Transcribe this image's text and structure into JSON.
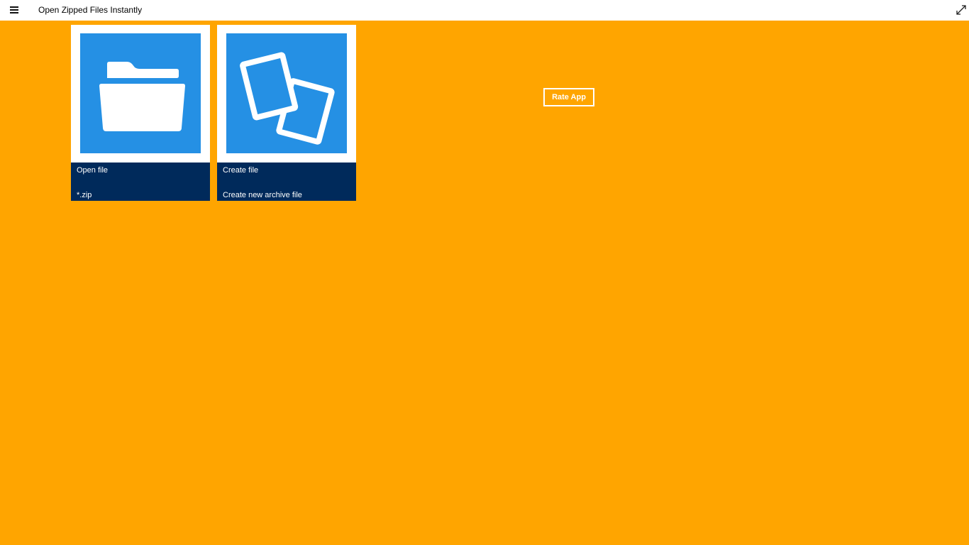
{
  "window": {
    "title": "Open Zipped Files Instantly",
    "menu_icon": "hamburger-menu-icon",
    "expand_icon": "expand-icon"
  },
  "tiles": [
    {
      "title": "Open file",
      "subtitle": "*.zip",
      "icon": "folder-icon"
    },
    {
      "title": "Create file",
      "subtitle": "Create new archive file",
      "icon": "documents-icon"
    }
  ],
  "rate_button": {
    "label": "Rate App"
  },
  "colors": {
    "background": "#FFA500",
    "tile_art": "#2590E4",
    "tile_caption": "#002A5B",
    "titlebar": "#FFFFFF"
  }
}
